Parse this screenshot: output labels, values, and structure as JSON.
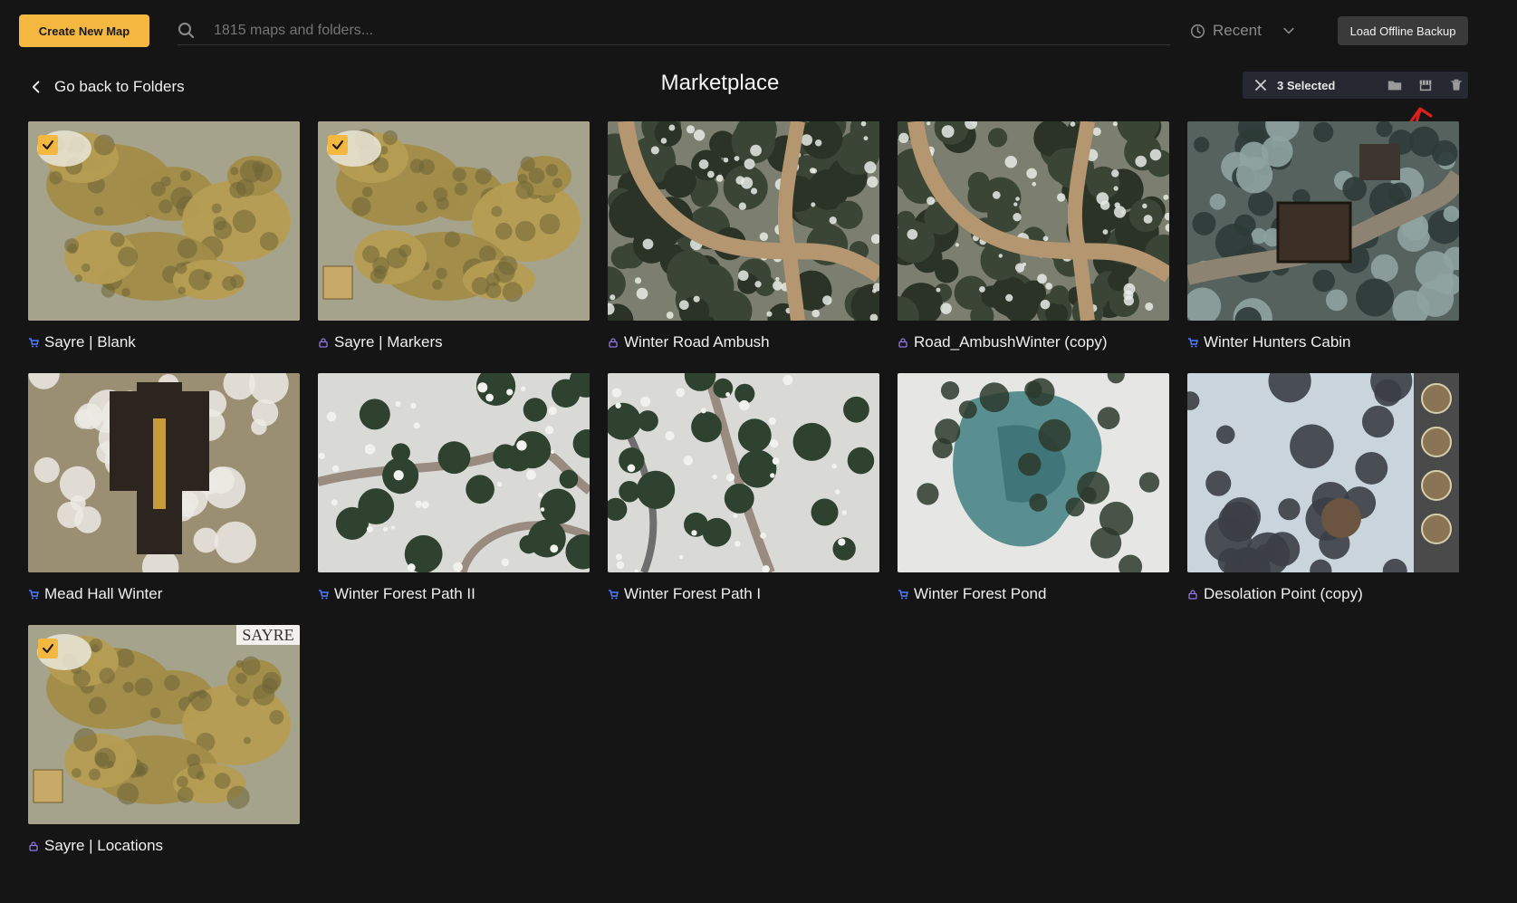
{
  "toolbar": {
    "create_label": "Create New Map",
    "search_placeholder": "1815 maps and folders...",
    "sort_label": "Recent",
    "backup_label": "Load Offline Backup"
  },
  "header": {
    "back_label": "Go back to Folders",
    "title": "Marketplace",
    "selected_label": "3 Selected"
  },
  "colors": {
    "accent": "#f4b73f",
    "marketplace_icon": "#4f7cff",
    "locked_icon": "#8e76e8"
  },
  "maps": [
    {
      "name": "Sayre | Blank",
      "icon": "cart-icon",
      "selected": true,
      "style": "world"
    },
    {
      "name": "Sayre | Markers",
      "icon": "lock-icon",
      "selected": true,
      "style": "world-legend"
    },
    {
      "name": "Winter Road Ambush",
      "icon": "lock-icon",
      "selected": false,
      "style": "road"
    },
    {
      "name": "Road_AmbushWinter (copy)",
      "icon": "lock-icon",
      "selected": false,
      "style": "road"
    },
    {
      "name": "Winter Hunters Cabin",
      "icon": "cart-icon",
      "selected": false,
      "style": "cabin"
    },
    {
      "name": "Mead Hall Winter",
      "icon": "cart-icon",
      "selected": false,
      "style": "hall"
    },
    {
      "name": "Winter Forest Path II",
      "icon": "cart-icon",
      "selected": false,
      "style": "snowpath"
    },
    {
      "name": "Winter Forest Path I",
      "icon": "cart-icon",
      "selected": false,
      "style": "snowpath2"
    },
    {
      "name": "Winter Forest Pond",
      "icon": "cart-icon",
      "selected": false,
      "style": "pond"
    },
    {
      "name": "Desolation Point (copy)",
      "icon": "lock-icon",
      "selected": false,
      "style": "desolation"
    },
    {
      "name": "Sayre | Locations",
      "icon": "lock-icon",
      "selected": true,
      "style": "world-locations",
      "thumb_text": "SAYRE"
    }
  ]
}
